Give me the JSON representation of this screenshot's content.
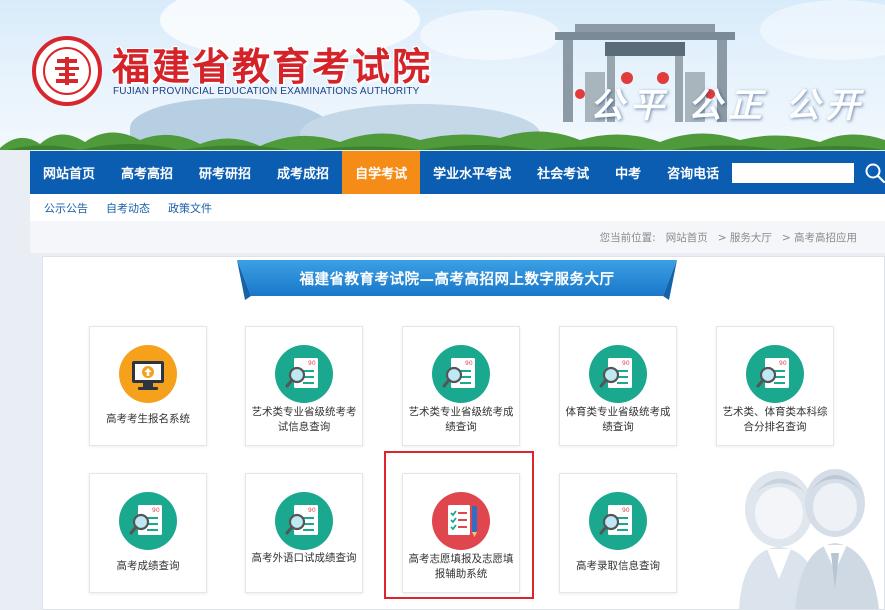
{
  "header": {
    "title": "福建省教育考试院",
    "subtitle": "FUJIAN PROVINCIAL EDUCATION EXAMINATIONS AUTHORITY",
    "slogan": "公平 公正 公开"
  },
  "nav": {
    "items": [
      {
        "label": "网站首页",
        "active": false
      },
      {
        "label": "高考高招",
        "active": false
      },
      {
        "label": "研考研招",
        "active": false
      },
      {
        "label": "成考成招",
        "active": false
      },
      {
        "label": "自学考试",
        "active": true
      },
      {
        "label": "学业水平考试",
        "active": false
      },
      {
        "label": "社会考试",
        "active": false
      },
      {
        "label": "中考",
        "active": false
      },
      {
        "label": "咨询电话",
        "active": false
      }
    ],
    "search_value": ""
  },
  "subnav": {
    "items": [
      "公示公告",
      "自考动态",
      "政策文件"
    ]
  },
  "breadcrumb": {
    "prefix": "您当前位置:",
    "items": [
      "网站首页",
      "> 服务大厅",
      "> 高考高招应用"
    ]
  },
  "panel": {
    "banner_title": "福建省教育考试院—高考高招网上数字服务大厅",
    "cards": [
      {
        "label": "高考考生报名系统",
        "icon": "monitor-upload-icon",
        "color": "#f5a11c"
      },
      {
        "label": "艺术类专业省级统考考试信息查询",
        "icon": "search-document-icon",
        "color": "#1aa88f"
      },
      {
        "label": "艺术类专业省级统考成绩查询",
        "icon": "search-document-icon",
        "color": "#1aa88f"
      },
      {
        "label": "体育类专业省级统考成绩查询",
        "icon": "search-document-icon",
        "color": "#1aa88f"
      },
      {
        "label": "艺术类、体育类本科综合分排名查询",
        "icon": "search-document-icon",
        "color": "#1aa88f"
      },
      {
        "label": "高考成绩查询",
        "icon": "search-document-icon",
        "color": "#1aa88f"
      },
      {
        "label": "高考外语口试成绩查询",
        "icon": "search-document-icon",
        "color": "#1aa88f"
      },
      {
        "label": "高考志愿填报及志愿填报辅助系统",
        "icon": "checklist-pen-icon",
        "color": "#e0464d"
      },
      {
        "label": "高考录取信息查询",
        "icon": "search-document-icon",
        "color": "#1aa88f"
      }
    ]
  },
  "colors": {
    "nav_bg": "#0b5db1",
    "nav_active": "#f58c18",
    "title_red": "#d4242a",
    "highlight": "#e0242a"
  }
}
